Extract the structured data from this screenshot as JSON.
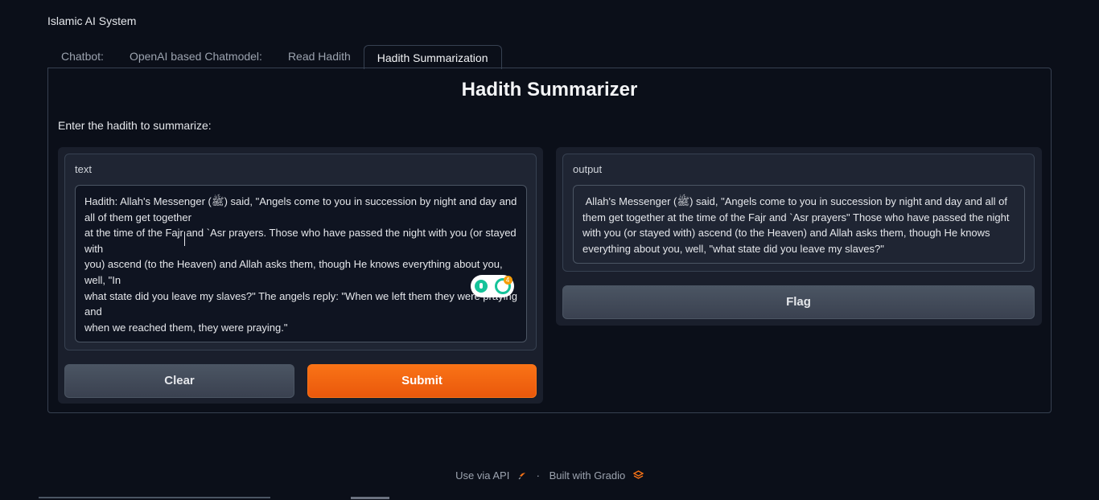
{
  "app": {
    "title": "Islamic AI System"
  },
  "tabs": [
    {
      "label": "Chatbot:"
    },
    {
      "label": "OpenAI based Chatmodel:"
    },
    {
      "label": "Read Hadith"
    },
    {
      "label": "Hadith Summarization",
      "selected": true
    }
  ],
  "main": {
    "heading": "Hadith Summarizer",
    "prompt": "Enter the hadith to summarize:",
    "input": {
      "label": "text",
      "value": "Hadith: Allah's Messenger (ﷺ) said, \"Angels come to you in succession by night and day and all of them get together\nat the time of the Fajr and `Asr prayers. Those who have passed the night with you (or stayed with\nyou) ascend (to the Heaven) and Allah asks them, though He knows everything about you, well, \"In\nwhat state did you leave my slaves?\" The angels reply: \"When we left them they were praying and\nwhen we reached them, they were praying.\""
    },
    "output": {
      "label": "output",
      "value": " Allah's Messenger (ﷺ) said, \"Angels come to you in succession by night and day and all of them get together at the time of the Fajr and `Asr prayers\" Those who have passed the night with you (or stayed with) ascend (to the Heaven) and Allah asks them, though He knows everything about you, well, \"what state did you leave my slaves?\""
    },
    "buttons": {
      "clear": "Clear",
      "submit": "Submit",
      "flag": "Flag"
    },
    "grammarly_badge": "4"
  },
  "footer": {
    "api": "Use via API",
    "sep": "·",
    "built": "Built with Gradio"
  },
  "colors": {
    "primary": "#f97316",
    "background": "#0b0f19"
  },
  "icons": [
    "grammarly-bulb-icon",
    "grammarly-logo-icon",
    "rocket-icon",
    "gradio-logo-icon"
  ]
}
